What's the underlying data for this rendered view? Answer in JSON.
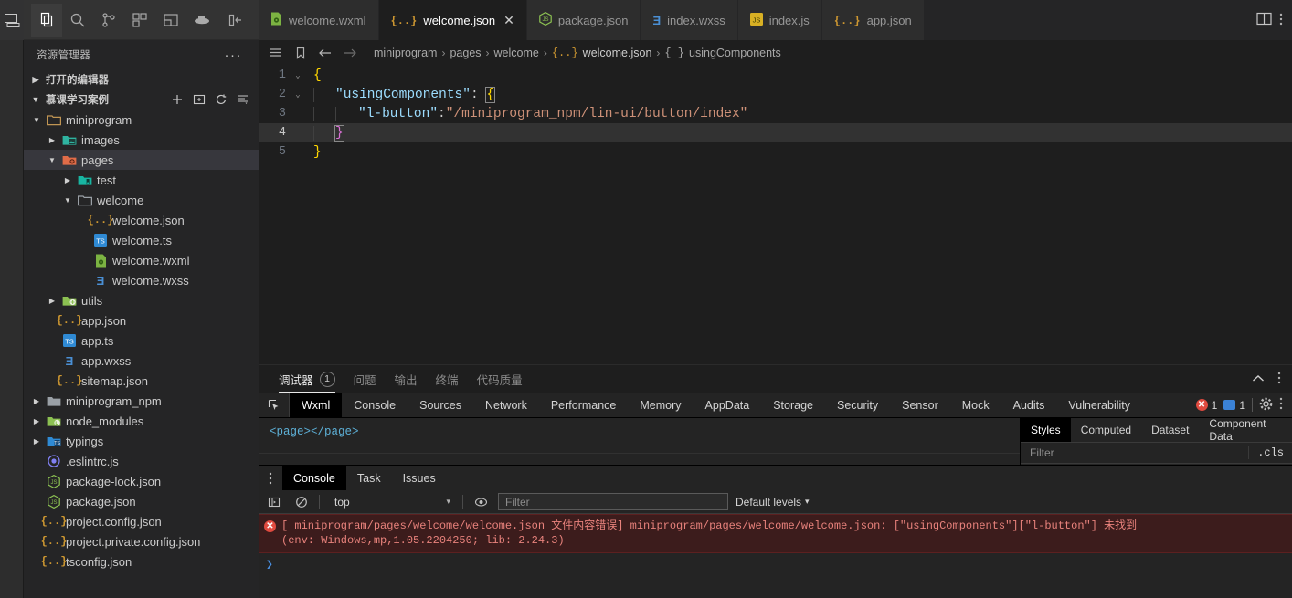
{
  "activitybar": {
    "icons": [
      {
        "name": "simulator-icon",
        "glyph": "simulator"
      }
    ]
  },
  "sidebar": {
    "actions": [
      {
        "name": "explorer-icon",
        "glyph": "files",
        "active": true
      },
      {
        "name": "search-icon",
        "glyph": "search",
        "active": false
      },
      {
        "name": "source-control-icon",
        "glyph": "branch",
        "active": false
      },
      {
        "name": "extensions-icon",
        "glyph": "blocks",
        "active": false
      },
      {
        "name": "cloud-icon",
        "glyph": "panels",
        "active": false
      },
      {
        "name": "docker-icon",
        "glyph": "docker",
        "active": false
      },
      {
        "name": "collapse-sidebar-icon",
        "glyph": "hide-panel",
        "active": false
      }
    ],
    "title": "资源管理器",
    "more_label": "···",
    "sections": [
      {
        "label": "打开的编辑器",
        "expanded": false
      },
      {
        "label": "慕课学习案例",
        "expanded": true
      }
    ],
    "section_tools": [
      {
        "name": "new-file-button",
        "glyph": "plus"
      },
      {
        "name": "new-folder-button",
        "glyph": "new-folder"
      },
      {
        "name": "refresh-explorer-button",
        "glyph": "refresh"
      },
      {
        "name": "collapse-folders-button",
        "glyph": "collapse-all"
      }
    ],
    "tree": [
      {
        "label": "miniprogram",
        "depth": 1,
        "type": "folder",
        "expanded": true,
        "icon": "folder-open",
        "color": "#c09553",
        "selected": false
      },
      {
        "label": "images",
        "depth": 2,
        "type": "folder",
        "expanded": false,
        "icon": "folder-images",
        "color": "#2fb3a0",
        "selected": false
      },
      {
        "label": "pages",
        "depth": 2,
        "type": "folder",
        "expanded": true,
        "icon": "folder-pages",
        "color": "#e06c48",
        "selected": true
      },
      {
        "label": "test",
        "depth": 3,
        "type": "folder",
        "expanded": false,
        "icon": "folder-test",
        "color": "#18b6a2",
        "selected": false
      },
      {
        "label": "welcome",
        "depth": 3,
        "type": "folder",
        "expanded": true,
        "icon": "folder-open",
        "color": "#9aa0a6",
        "selected": false
      },
      {
        "label": "welcome.json",
        "depth": 4,
        "type": "file",
        "icon": "json",
        "color": "#cd9731",
        "selected": false
      },
      {
        "label": "welcome.ts",
        "depth": 4,
        "type": "file",
        "icon": "ts",
        "color": "#2f8ad4",
        "selected": false
      },
      {
        "label": "welcome.wxml",
        "depth": 4,
        "type": "file",
        "icon": "wxml",
        "color": "#7cb342",
        "selected": false
      },
      {
        "label": "welcome.wxss",
        "depth": 4,
        "type": "file",
        "icon": "wxss",
        "color": "#4a8fd4",
        "selected": false
      },
      {
        "label": "utils",
        "depth": 2,
        "type": "folder",
        "expanded": false,
        "icon": "folder-utils",
        "color": "#8cc152",
        "selected": false
      },
      {
        "label": "app.json",
        "depth": 2,
        "type": "file",
        "icon": "json",
        "color": "#cd9731",
        "selected": false
      },
      {
        "label": "app.ts",
        "depth": 2,
        "type": "file",
        "icon": "ts",
        "color": "#2f8ad4",
        "selected": false
      },
      {
        "label": "app.wxss",
        "depth": 2,
        "type": "file",
        "icon": "wxss",
        "color": "#4a8fd4",
        "selected": false
      },
      {
        "label": "sitemap.json",
        "depth": 2,
        "type": "file",
        "icon": "json",
        "color": "#cd9731",
        "selected": false
      },
      {
        "label": "miniprogram_npm",
        "depth": 1,
        "type": "folder",
        "expanded": false,
        "icon": "folder-plain",
        "color": "#9aa0a6",
        "selected": false
      },
      {
        "label": "node_modules",
        "depth": 1,
        "type": "folder",
        "expanded": false,
        "icon": "folder-node",
        "color": "#8cc152",
        "selected": false
      },
      {
        "label": "typings",
        "depth": 1,
        "type": "folder",
        "expanded": false,
        "icon": "folder-ts",
        "color": "#2f8ad4",
        "selected": false
      },
      {
        "label": ".eslintrc.js",
        "depth": 1,
        "type": "file",
        "icon": "eslint",
        "color": "#8080f2",
        "selected": false
      },
      {
        "label": "package-lock.json",
        "depth": 1,
        "type": "file",
        "icon": "npm",
        "color": "#8cc152",
        "selected": false
      },
      {
        "label": "package.json",
        "depth": 1,
        "type": "file",
        "icon": "npm",
        "color": "#8cc152",
        "selected": false
      },
      {
        "label": "project.config.json",
        "depth": 1,
        "type": "file",
        "icon": "json",
        "color": "#cd9731",
        "selected": false
      },
      {
        "label": "project.private.config.json",
        "depth": 1,
        "type": "file",
        "icon": "json",
        "color": "#cd9731",
        "selected": false
      },
      {
        "label": "tsconfig.json",
        "depth": 1,
        "type": "file",
        "icon": "json",
        "color": "#cd9731",
        "selected": false
      }
    ]
  },
  "editor": {
    "tabs": [
      {
        "label": "welcome.wxml",
        "icon": "wxml",
        "color": "#7cb342",
        "active": false,
        "closable": false
      },
      {
        "label": "welcome.json",
        "icon": "json",
        "color": "#cd9731",
        "active": true,
        "closable": true,
        "close_label": "✕"
      },
      {
        "label": "package.json",
        "icon": "npm",
        "color": "#8cc152",
        "active": false,
        "closable": false
      },
      {
        "label": "index.wxss",
        "icon": "wxss",
        "color": "#4a8fd4",
        "active": false,
        "closable": false
      },
      {
        "label": "index.js",
        "icon": "js",
        "color": "#d8b024",
        "active": false,
        "closable": false
      },
      {
        "label": "app.json",
        "icon": "json",
        "color": "#cd9731",
        "active": false,
        "closable": false
      }
    ],
    "tab_actions": [
      {
        "name": "split-editor-icon",
        "glyph": "split"
      },
      {
        "name": "more-actions-icon",
        "glyph": "kebab"
      }
    ],
    "breadcrumb_icons": [
      {
        "name": "outline-icon",
        "glyph": "list"
      },
      {
        "name": "bookmark-icon",
        "glyph": "bookmark"
      },
      {
        "name": "navigate-back-icon",
        "glyph": "arrow-left"
      },
      {
        "name": "navigate-forward-icon",
        "glyph": "arrow-right"
      }
    ],
    "breadcrumbs": [
      {
        "label": "miniprogram",
        "kind": "folder"
      },
      {
        "label": "pages",
        "kind": "folder"
      },
      {
        "label": "welcome",
        "kind": "folder"
      },
      {
        "label": "welcome.json",
        "kind": "file"
      },
      {
        "label": "usingComponents",
        "kind": "symbol"
      }
    ],
    "breadcrumb_sep": "›",
    "lines": [
      {
        "num": "1",
        "fold": "v",
        "current": false,
        "tokens": [
          {
            "t": "{",
            "c": "tk-punct"
          }
        ],
        "indent": 0
      },
      {
        "num": "2",
        "fold": "v",
        "current": false,
        "tokens": [
          {
            "t": "\"usingComponents\"",
            "c": "tk-key"
          },
          {
            "t": ": ",
            "c": "tk-colon"
          },
          {
            "t": "{",
            "c": "tk-punct-box"
          }
        ],
        "indent": 1
      },
      {
        "num": "3",
        "fold": "",
        "current": false,
        "tokens": [
          {
            "t": "\"l-button\"",
            "c": "tk-key"
          },
          {
            "t": ":",
            "c": "tk-colon"
          },
          {
            "t": "\"/miniprogram_npm/lin-ui/button/index\"",
            "c": "tk-str"
          }
        ],
        "indent": 2
      },
      {
        "num": "4",
        "fold": "",
        "current": true,
        "tokens": [
          {
            "t": "}",
            "c": "tk-punct2-box"
          }
        ],
        "indent": 1
      },
      {
        "num": "5",
        "fold": "",
        "current": false,
        "tokens": [
          {
            "t": "}",
            "c": "tk-punct"
          }
        ],
        "indent": 0
      }
    ]
  },
  "panel": {
    "tabs": [
      {
        "label": "调试器",
        "badge": "1",
        "active": true
      },
      {
        "label": "问题",
        "badge": null,
        "active": false
      },
      {
        "label": "输出",
        "badge": null,
        "active": false
      },
      {
        "label": "终端",
        "badge": null,
        "active": false
      },
      {
        "label": "代码质量",
        "badge": null,
        "active": false
      }
    ],
    "actions": [
      {
        "name": "collapse-panel-icon",
        "glyph": "chevron-up"
      },
      {
        "name": "panel-more-icon",
        "glyph": "kebab"
      }
    ]
  },
  "devtools": {
    "inspect_icon": "cursor-select-icon",
    "tabs": [
      {
        "label": "Wxml",
        "active": true
      },
      {
        "label": "Console",
        "active": false
      },
      {
        "label": "Sources",
        "active": false
      },
      {
        "label": "Network",
        "active": false
      },
      {
        "label": "Performance",
        "active": false
      },
      {
        "label": "Memory",
        "active": false
      },
      {
        "label": "AppData",
        "active": false
      },
      {
        "label": "Storage",
        "active": false
      },
      {
        "label": "Security",
        "active": false
      },
      {
        "label": "Sensor",
        "active": false
      },
      {
        "label": "Mock",
        "active": false
      },
      {
        "label": "Audits",
        "active": false
      },
      {
        "label": "Vulnerability",
        "active": false
      }
    ],
    "error_count": "1",
    "message_count": "1",
    "right_icons": [
      {
        "name": "devtools-settings-icon",
        "glyph": "gear"
      },
      {
        "name": "devtools-more-icon",
        "glyph": "kebab"
      }
    ],
    "wxml_content": "<page></page>",
    "styles": {
      "tabs": [
        {
          "label": "Styles",
          "active": true
        },
        {
          "label": "Computed",
          "active": false
        },
        {
          "label": "Dataset",
          "active": false
        },
        {
          "label": "Component Data",
          "active": false
        }
      ],
      "filter_placeholder": "Filter",
      "cls_label": ".cls"
    }
  },
  "console": {
    "tabs": [
      {
        "label": "Console",
        "active": true
      },
      {
        "label": "Task",
        "active": false
      },
      {
        "label": "Issues",
        "active": false
      }
    ],
    "toolbar": {
      "sidebar_toggle_icon": "console-sidebar-icon",
      "clear_icon": "clear-console-icon",
      "context_value": "top",
      "context_caret": "▾",
      "eye_icon": "live-expression-icon",
      "filter_placeholder": "Filter",
      "levels_label": "Default levels",
      "levels_caret": "▾"
    },
    "messages": [
      {
        "severity": "error",
        "line1": "[ miniprogram/pages/welcome/welcome.json 文件内容错误] miniprogram/pages/welcome/welcome.json: [\"usingComponents\"][\"l-button\"] 未找到",
        "line2": "(env: Windows,mp,1.05.2204250; lib: 2.24.3)"
      }
    ],
    "prompt_symbol": "❯"
  },
  "colors": {
    "accent_error": "#e04a3f",
    "accent_blue": "#3b82d6",
    "editor_bg": "#1e1e1e",
    "sidebar_bg": "#252526",
    "string": "#ce9178",
    "key": "#9cdcfe"
  }
}
